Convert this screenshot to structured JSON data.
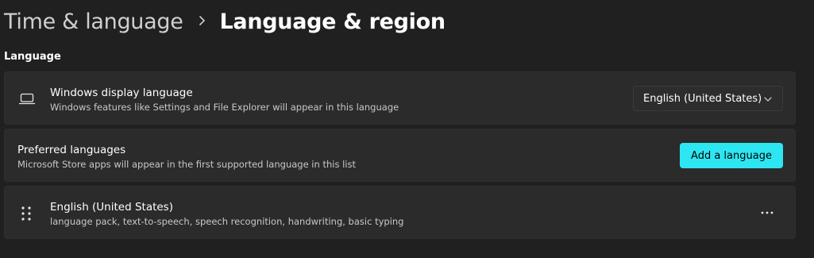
{
  "breadcrumb": {
    "parent": "Time & language",
    "separator_icon": "chevron-right-icon",
    "current": "Language & region"
  },
  "language_section": {
    "title": "Language",
    "display_language": {
      "icon": "laptop-icon",
      "title": "Windows display language",
      "subtitle": "Windows features like Settings and File Explorer will appear in this language",
      "selected_value": "English (United States)",
      "dropdown_icon": "chevron-down-icon"
    },
    "preferred_languages": {
      "title": "Preferred languages",
      "subtitle": "Microsoft Store apps will appear in the first supported language in this list",
      "add_button_label": "Add a language"
    },
    "languages": [
      {
        "name": "English (United States)",
        "features": "language pack, text-to-speech, speech recognition, handwriting, basic typing",
        "handle_icon": "drag-handle-icon",
        "menu_icon": "more-options-icon"
      }
    ]
  },
  "colors": {
    "background": "#202020",
    "card": "#2b2b2b",
    "accent": "#2ee6f2"
  }
}
